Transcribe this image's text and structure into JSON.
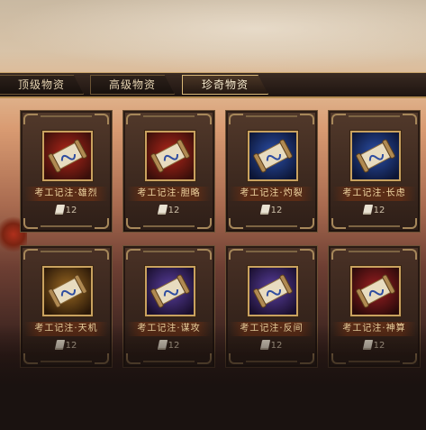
{
  "tabs": [
    {
      "label": "顶级物资"
    },
    {
      "label": "高级物资"
    },
    {
      "label": "珍奇物资"
    }
  ],
  "active_tab": 2,
  "items": [
    {
      "name": "考工记注·雄烈",
      "count": "12",
      "theme": "red"
    },
    {
      "name": "考工记注·胆略",
      "count": "12",
      "theme": "red"
    },
    {
      "name": "考工记注·灼裂",
      "count": "12",
      "theme": "blue"
    },
    {
      "name": "考工记注·长虑",
      "count": "12",
      "theme": "blue"
    },
    {
      "name": "考工记注·天机",
      "count": "12",
      "theme": "gold"
    },
    {
      "name": "考工记注·谋攻",
      "count": "12",
      "theme": "purple"
    },
    {
      "name": "考工记注·反间",
      "count": "12",
      "theme": "purple"
    },
    {
      "name": "考工记注·神算",
      "count": "12",
      "theme": "crimson"
    }
  ],
  "icon_names": {
    "item": "scroll-icon",
    "count": "paper-icon"
  },
  "colors": {
    "red": [
      "#3a0f0a",
      "#b2261a"
    ],
    "blue": [
      "#0c1535",
      "#2b4fa8"
    ],
    "gold": [
      "#2a1808",
      "#9c6a22"
    ],
    "purple": [
      "#1a0f2e",
      "#5a3fa0"
    ],
    "crimson": [
      "#2a0a0a",
      "#9e1f22"
    ]
  }
}
